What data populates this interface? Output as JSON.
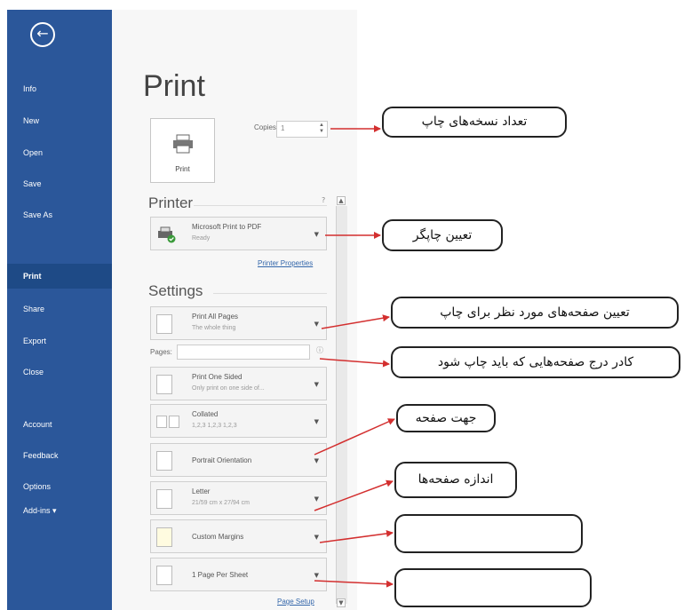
{
  "nav": {
    "items": [
      "Info",
      "New",
      "Open",
      "Save",
      "Save As",
      "Print",
      "Share",
      "Export",
      "Close",
      "Account",
      "Feedback",
      "Options",
      "Add-ins ▾"
    ],
    "selected": "Print"
  },
  "title": "Print",
  "print_button_label": "Print",
  "copies": {
    "label": "Copies:",
    "value": "1"
  },
  "printer": {
    "section_title": "Printer",
    "name": "Microsoft Print to PDF",
    "status": "Ready",
    "properties_link": "Printer Properties"
  },
  "settings": {
    "section_title": "Settings",
    "print_range": {
      "main": "Print All Pages",
      "sub": "The whole thing"
    },
    "pages_label": "Pages:",
    "sides": {
      "main": "Print One Sided",
      "sub": "Only print on one side of..."
    },
    "collation": {
      "main": "Collated",
      "sub": "1,2,3    1,2,3    1,2,3"
    },
    "orientation": "Portrait Orientation",
    "paper": {
      "main": "Letter",
      "sub": "21/59 cm x 27/94 cm"
    },
    "margins": "Custom Margins",
    "per_sheet": "1 Page Per Sheet",
    "page_setup_link": "Page Setup"
  },
  "callouts": {
    "copies": "تعداد نسخه‌های چاپ",
    "printer": "تعیین چاپگر",
    "pages": "تعیین صفحه‌های مورد نظر برای چاپ",
    "pages_box": "کادر درج صفحه‌هایی که باید چاپ شود",
    "orientation": "جهت صفحه",
    "size": "اندازه صفحه‌ها",
    "margins": "",
    "per_sheet": ""
  },
  "colors": {
    "sidebar": "#2b579a",
    "arrow": "#d32f2f"
  }
}
